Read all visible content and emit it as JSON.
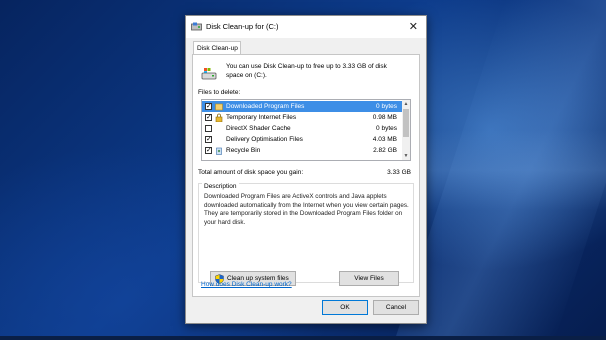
{
  "window": {
    "title": "Disk Clean-up for  (C:)",
    "close_glyph": "✕"
  },
  "tab": {
    "label": "Disk Clean-up"
  },
  "intro_text": "You can use Disk Clean-up to free up to 3.33 GB of disk space on  (C:).",
  "files_label": "Files to delete:",
  "files": [
    {
      "checked": true,
      "name": "Downloaded Program Files",
      "size": "0 bytes",
      "icon": "folder-icon",
      "selected": true
    },
    {
      "checked": true,
      "name": "Temporary Internet Files",
      "size": "0.98 MB",
      "icon": "lock-icon",
      "selected": false
    },
    {
      "checked": false,
      "name": "DirectX Shader Cache",
      "size": "0 bytes",
      "icon": "blank-icon",
      "selected": false
    },
    {
      "checked": true,
      "name": "Delivery Optimisation Files",
      "size": "4.03 MB",
      "icon": "blank-icon",
      "selected": false
    },
    {
      "checked": true,
      "name": "Recycle Bin",
      "size": "2.82 GB",
      "icon": "recycle-bin-icon",
      "selected": false
    }
  ],
  "checkmark": "✓",
  "total": {
    "label": "Total amount of disk space you gain:",
    "value": "3.33 GB"
  },
  "description": {
    "legend": "Description",
    "text": "Downloaded Program Files are ActiveX controls and Java applets downloaded automatically from the Internet when you view certain pages. They are temporarily stored in the Downloaded Program Files folder on your hard disk."
  },
  "buttons": {
    "cleanup_system": "Clean up system files",
    "view_files": "View Files",
    "ok": "OK",
    "cancel": "Cancel"
  },
  "help_link": "How does Disk Clean-up work?",
  "colors": {
    "selection": "#3d8ee6",
    "link": "#0066cc",
    "accent": "#0078d7"
  }
}
